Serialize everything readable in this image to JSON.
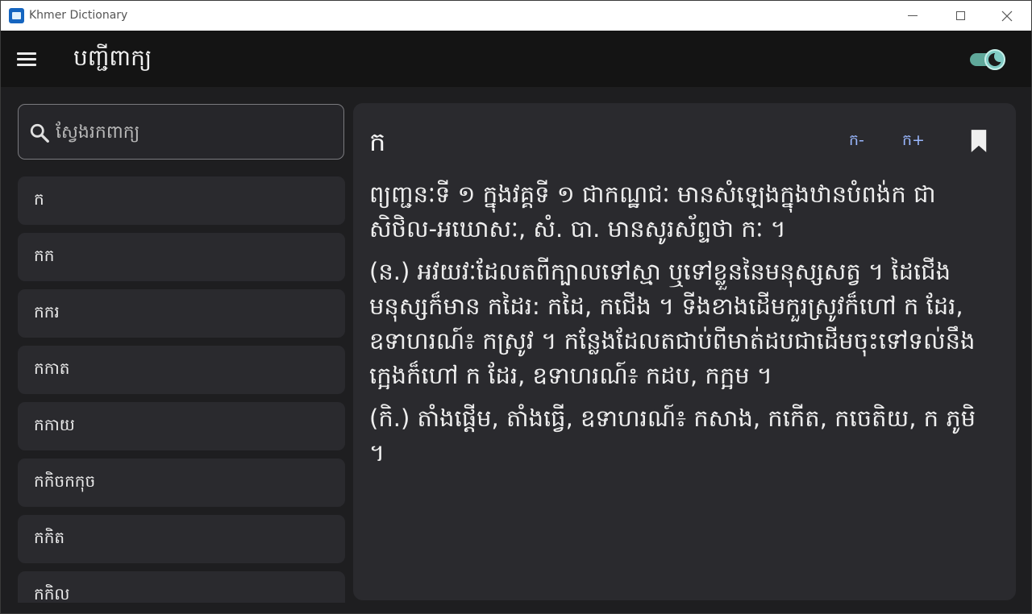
{
  "window": {
    "title": "Khmer Dictionary",
    "min_icon": "minimize-icon",
    "max_icon": "maximize-icon",
    "close_icon": "close-icon"
  },
  "appbar": {
    "title": "បញ្ជីពាក្យ",
    "menu_icon": "hamburger-menu-icon",
    "theme_toggle_icon": "dark-mode-toggle-icon",
    "theme_toggle_on": true,
    "accent_color": "#80cbc4"
  },
  "search": {
    "placeholder": "ស្វែងរកពាក្យ",
    "value": "",
    "icon": "search-icon"
  },
  "word_list": {
    "items": [
      "ក",
      "កក",
      "កករ",
      "កកាត",
      "កកាយ",
      "កកិចកកុច",
      "កកិត",
      "កកិល"
    ]
  },
  "entry": {
    "headword": "ក",
    "font_decrease_label": "ក-",
    "font_increase_label": "ក+",
    "bookmark_icon": "bookmark-icon",
    "link_color": "#9ab8ff",
    "definitions": [
      "ព្យញ្ជនៈទី ១ ក្នុងវគ្គទី ១ ជាកណ្ឋជៈ មានសំឡេងក្នុងឋានបំពង់ក ជាសិថិល-អឃោសៈ, សំ. បា. មានសូរស័ព្ទថា កៈ ។",
      "(ន.) អវយវៈដែលតពីក្បាលទៅស្មា ឬទៅខ្លួននៃមនុស្សសត្វ ។ ដៃជើងមនុស្សក៏មាន កដៃរ: កដៃ, កជើង ។ ទីងខាងដើមកួរស្រូវក៏ហៅ ក ដែរ, ឧទាហរណ៍៖ កស្រូវ ។ កន្លែងដែលតជាប់ពីមាត់ដបជាដើមចុះទៅទល់នឹងក្អេងក៏ហៅ ក ដែរ, ឧទាហរណ៍៖ កដប, កក្អម ។",
      "(កិ.) តាំងផ្តើម, តាំងធ្វើ, ឧទាហរណ៍៖ កសាង, កកើត, កចេតិយ, ក ភូមិ ។"
    ]
  }
}
